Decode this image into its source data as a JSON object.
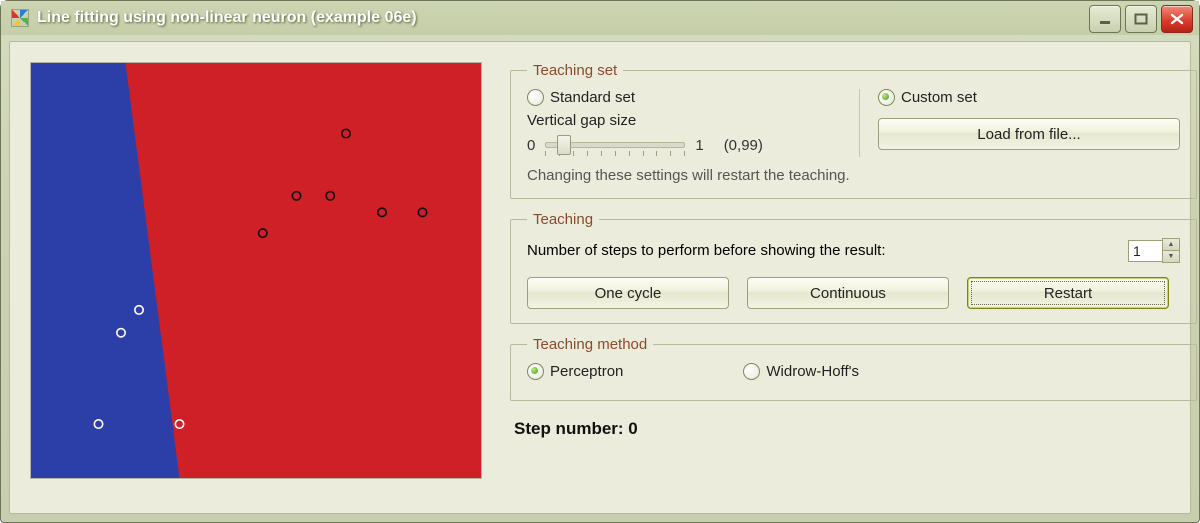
{
  "window": {
    "title": "Line fitting using non-linear neuron (example 06e)"
  },
  "teaching_set": {
    "legend": "Teaching set",
    "standard_label": "Standard set",
    "custom_label": "Custom set",
    "selected": "custom",
    "vertical_gap_label": "Vertical gap size",
    "slider_min_label": "0",
    "slider_max_label": "1",
    "slider_value_display": "(0,99)",
    "load_button": "Load from file...",
    "hint": "Changing these settings will restart the teaching."
  },
  "teaching": {
    "legend": "Teaching",
    "steps_label": "Number of steps to perform before showing the result:",
    "steps_value": "1",
    "one_cycle": "One cycle",
    "continuous": "Continuous",
    "restart": "Restart"
  },
  "method": {
    "legend": "Teaching method",
    "perceptron": "Perceptron",
    "widrow": "Widrow-Hoff's",
    "selected": "perceptron"
  },
  "status": {
    "step_label": "Step number: 0"
  },
  "chart_data": {
    "type": "scatter",
    "title": "",
    "xlim": [
      0,
      1
    ],
    "ylim": [
      0,
      1
    ],
    "boundary": {
      "x_top": 0.21,
      "x_bottom": 0.33
    },
    "series": [
      {
        "name": "class-blue",
        "points": [
          {
            "x": 0.24,
            "y": 0.405
          },
          {
            "x": 0.2,
            "y": 0.35
          },
          {
            "x": 0.15,
            "y": 0.13
          },
          {
            "x": 0.33,
            "y": 0.13
          }
        ]
      },
      {
        "name": "class-red",
        "points": [
          {
            "x": 0.7,
            "y": 0.83
          },
          {
            "x": 0.59,
            "y": 0.68
          },
          {
            "x": 0.665,
            "y": 0.68
          },
          {
            "x": 0.78,
            "y": 0.64
          },
          {
            "x": 0.87,
            "y": 0.64
          },
          {
            "x": 0.515,
            "y": 0.59
          }
        ]
      }
    ]
  }
}
